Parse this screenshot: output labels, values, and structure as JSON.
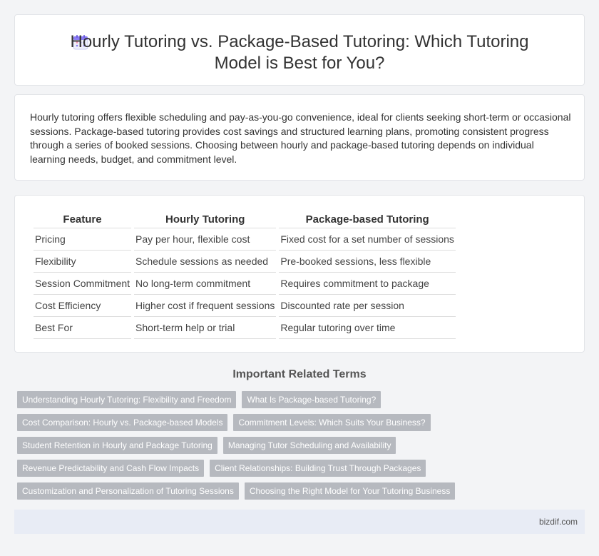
{
  "header": {
    "title": "Hourly Tutoring vs. Package-Based Tutoring: Which Tutoring Model is Best for You?",
    "icon": "calendar-icon"
  },
  "intro": {
    "text": "Hourly tutoring offers flexible scheduling and pay-as-you-go convenience, ideal for clients seeking short-term or occasional sessions. Package-based tutoring provides cost savings and structured learning plans, promoting consistent progress through a series of booked sessions. Choosing between hourly and package-based tutoring depends on individual learning needs, budget, and commitment level."
  },
  "table": {
    "headers": [
      "Feature",
      "Hourly Tutoring",
      "Package-based Tutoring"
    ],
    "rows": [
      [
        "Pricing",
        "Pay per hour, flexible cost",
        "Fixed cost for a set number of sessions"
      ],
      [
        "Flexibility",
        "Schedule sessions as needed",
        "Pre-booked sessions, less flexible"
      ],
      [
        "Session Commitment",
        "No long-term commitment",
        "Requires commitment to package"
      ],
      [
        "Cost Efficiency",
        "Higher cost if frequent sessions",
        "Discounted rate per session"
      ],
      [
        "Best For",
        "Short-term help or trial",
        "Regular tutoring over time"
      ]
    ]
  },
  "related": {
    "title": "Important Related Terms",
    "tags": [
      "Understanding Hourly Tutoring: Flexibility and Freedom",
      "What Is Package-based Tutoring?",
      "Cost Comparison: Hourly vs. Package-based Models",
      "Commitment Levels: Which Suits Your Business?",
      "Student Retention in Hourly and Package Tutoring",
      "Managing Tutor Scheduling and Availability",
      "Revenue Predictability and Cash Flow Impacts",
      "Client Relationships: Building Trust Through Packages",
      "Customization and Personalization of Tutoring Sessions",
      "Choosing the Right Model for Your Tutoring Business"
    ]
  },
  "footer": {
    "site": "bizdif.com"
  },
  "colors": {
    "background": "#f3f4f6",
    "tag_bg": "#b6b9bf",
    "footer_bg": "#e8ecf5",
    "icon_accent": "#8b7cf6"
  }
}
